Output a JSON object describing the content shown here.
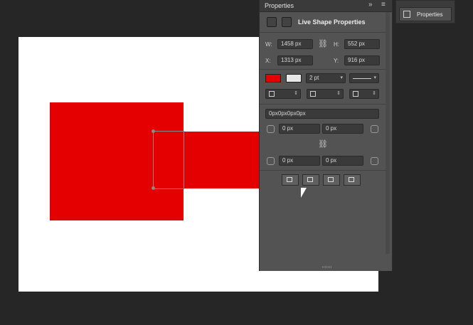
{
  "panel": {
    "title": "Properties",
    "section_title": "Live Shape Properties",
    "size": {
      "w_label": "W:",
      "w_value": "1458 px",
      "h_label": "H:",
      "h_value": "552 px"
    },
    "position": {
      "x_label": "X:",
      "x_value": "1313 px",
      "y_label": "Y:",
      "y_value": "916 px"
    },
    "stroke": {
      "fill_color": "#e50000",
      "width_value": "2 pt"
    },
    "corners": {
      "summary": "0px0px0px0px",
      "top_left": "0 px",
      "top_right": "0 px",
      "bottom_left": "0 px",
      "bottom_right": "0 px"
    }
  },
  "mini_panel": {
    "label": "Properties",
    "icon": "properties-icon"
  },
  "canvas": {
    "background": "#ffffff",
    "shape_color": "#e50000"
  }
}
